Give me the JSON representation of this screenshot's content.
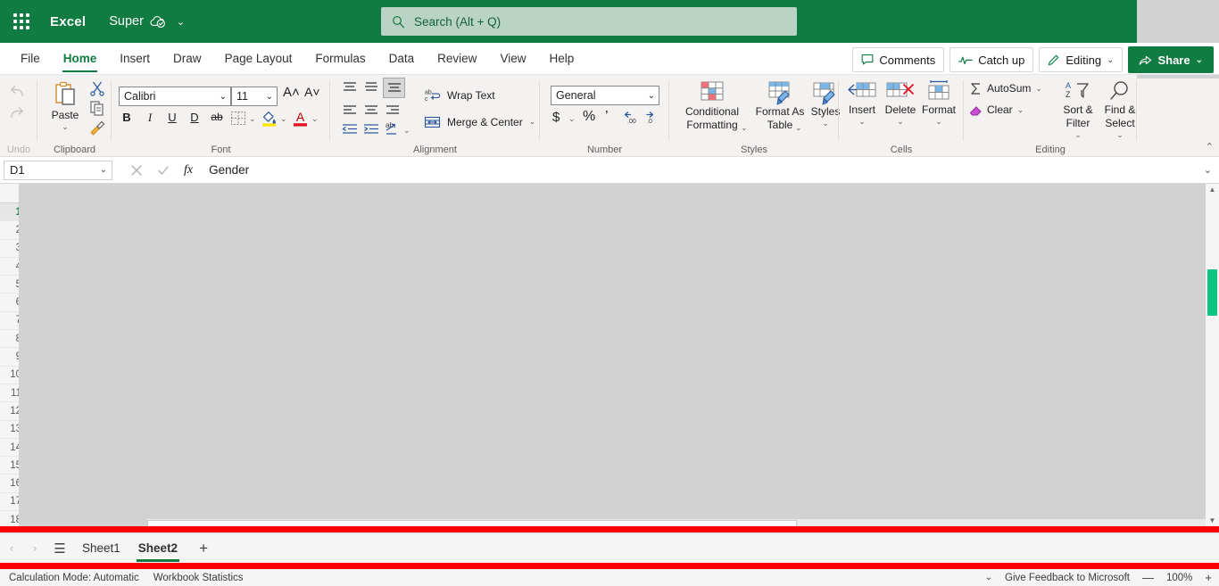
{
  "titlebar": {
    "waffle_name": "app-launcher",
    "app_name": "Excel",
    "doc_title": "Super",
    "cloud_icon": "cloud-saved-icon",
    "title_chevron": "⌄"
  },
  "search": {
    "icon": "search-icon",
    "placeholder": "Search (Alt + Q)"
  },
  "tabs": [
    {
      "label": "File",
      "active": false
    },
    {
      "label": "Home",
      "active": true
    },
    {
      "label": "Insert",
      "active": false
    },
    {
      "label": "Draw",
      "active": false
    },
    {
      "label": "Page Layout",
      "active": false
    },
    {
      "label": "Formulas",
      "active": false
    },
    {
      "label": "Data",
      "active": false
    },
    {
      "label": "Review",
      "active": false
    },
    {
      "label": "View",
      "active": false
    },
    {
      "label": "Help",
      "active": false
    }
  ],
  "tab_actions": {
    "comments": "Comments",
    "catch_up": "Catch up",
    "editing": "Editing",
    "share": "Share",
    "chevron": "⌄"
  },
  "ribbon": {
    "undo_group": {
      "label": "Undo",
      "undo_icon": "undo-icon",
      "redo_icon": "redo-icon"
    },
    "clipboard": {
      "label": "Clipboard",
      "paste": "Paste",
      "cut_icon": "cut-icon",
      "copy_icon": "copy-icon",
      "format_painter_icon": "format-painter-icon",
      "chevron": "⌄"
    },
    "font": {
      "label": "Font",
      "font_name": "Calibri",
      "font_size": "11",
      "grow_font": "A˄",
      "shrink_font": "A˅",
      "bold": "B",
      "italic": "I",
      "underline": "U",
      "double_underline": "D",
      "strikethrough": "ab",
      "borders_icon": "borders-icon",
      "fill_color_icon": "fill-color-icon",
      "font_color_icon": "font-color-icon",
      "chevron": "⌄"
    },
    "alignment": {
      "label": "Alignment",
      "wrap_text": "Wrap Text",
      "merge_center": "Merge & Center",
      "top_align_icon": "align-top-icon",
      "middle_align_icon": "align-middle-icon",
      "bottom_align_icon": "align-bottom-icon",
      "left_align_icon": "align-left-icon",
      "center_align_icon": "align-center-icon",
      "right_align_icon": "align-right-icon",
      "decrease_indent_icon": "decrease-indent-icon",
      "increase_indent_icon": "increase-indent-icon",
      "orientation_icon": "text-orientation-icon",
      "chevron": "⌄"
    },
    "number": {
      "label": "Number",
      "format": "General",
      "currency": "$",
      "percent": "%",
      "comma": "’",
      "increase_decimal_icon": "increase-decimal-icon",
      "decrease_decimal_icon": "decrease-decimal-icon",
      "chevron": "⌄"
    },
    "styles": {
      "label": "Styles",
      "conditional_formatting": "Conditional Formatting",
      "format_as_table": "Format As Table",
      "styles": "Styles",
      "chevron": "⌄"
    },
    "cells": {
      "label": "Cells",
      "insert": "Insert",
      "delete": "Delete",
      "format": "Format",
      "chevron": "⌄"
    },
    "editing": {
      "label": "Editing",
      "autosum": "AutoSum",
      "clear": "Clear",
      "sort_filter": "Sort & Filter",
      "find_select": "Find & Select",
      "chevron": "⌄"
    },
    "collapse_icon": "collapse-ribbon-icon",
    "collapse_glyph": "⌃"
  },
  "formulabar": {
    "namebox_value": "D1",
    "namebox_chevron": "⌄",
    "cancel_icon": "cancel-icon",
    "enter_icon": "confirm-icon",
    "fx_label": "fx",
    "formula_value": "Gender",
    "expand_glyph": "⌄"
  },
  "grid": {
    "selected_row": 1,
    "row_headers": [
      "1",
      "2",
      "3",
      "4",
      "5",
      "6",
      "7",
      "8",
      "9",
      "10",
      "11",
      "12",
      "13",
      "14",
      "15",
      "16",
      "17",
      "18"
    ]
  },
  "scrollbars": {
    "vertical_thumb_color": "#0bc47f",
    "vertical_name": "vertical-scrollbar",
    "horizontal_name": "horizontal-scrollbar"
  },
  "highlight": {
    "color": "#fe0000"
  },
  "sheettabs": {
    "prev_glyph": "‹",
    "next_glyph": "›",
    "all_sheets_glyph": "☰",
    "items": [
      {
        "label": "Sheet1",
        "active": false
      },
      {
        "label": "Sheet2",
        "active": true
      }
    ],
    "add_glyph": "+"
  },
  "statusbar": {
    "calc_mode": "Calculation Mode: Automatic",
    "workbook_stats": "Workbook Statistics",
    "options_chevron": "⌄",
    "feedback": "Give Feedback to Microsoft",
    "zoom_out": "—",
    "zoom_level": "100%",
    "zoom_in": "+"
  }
}
